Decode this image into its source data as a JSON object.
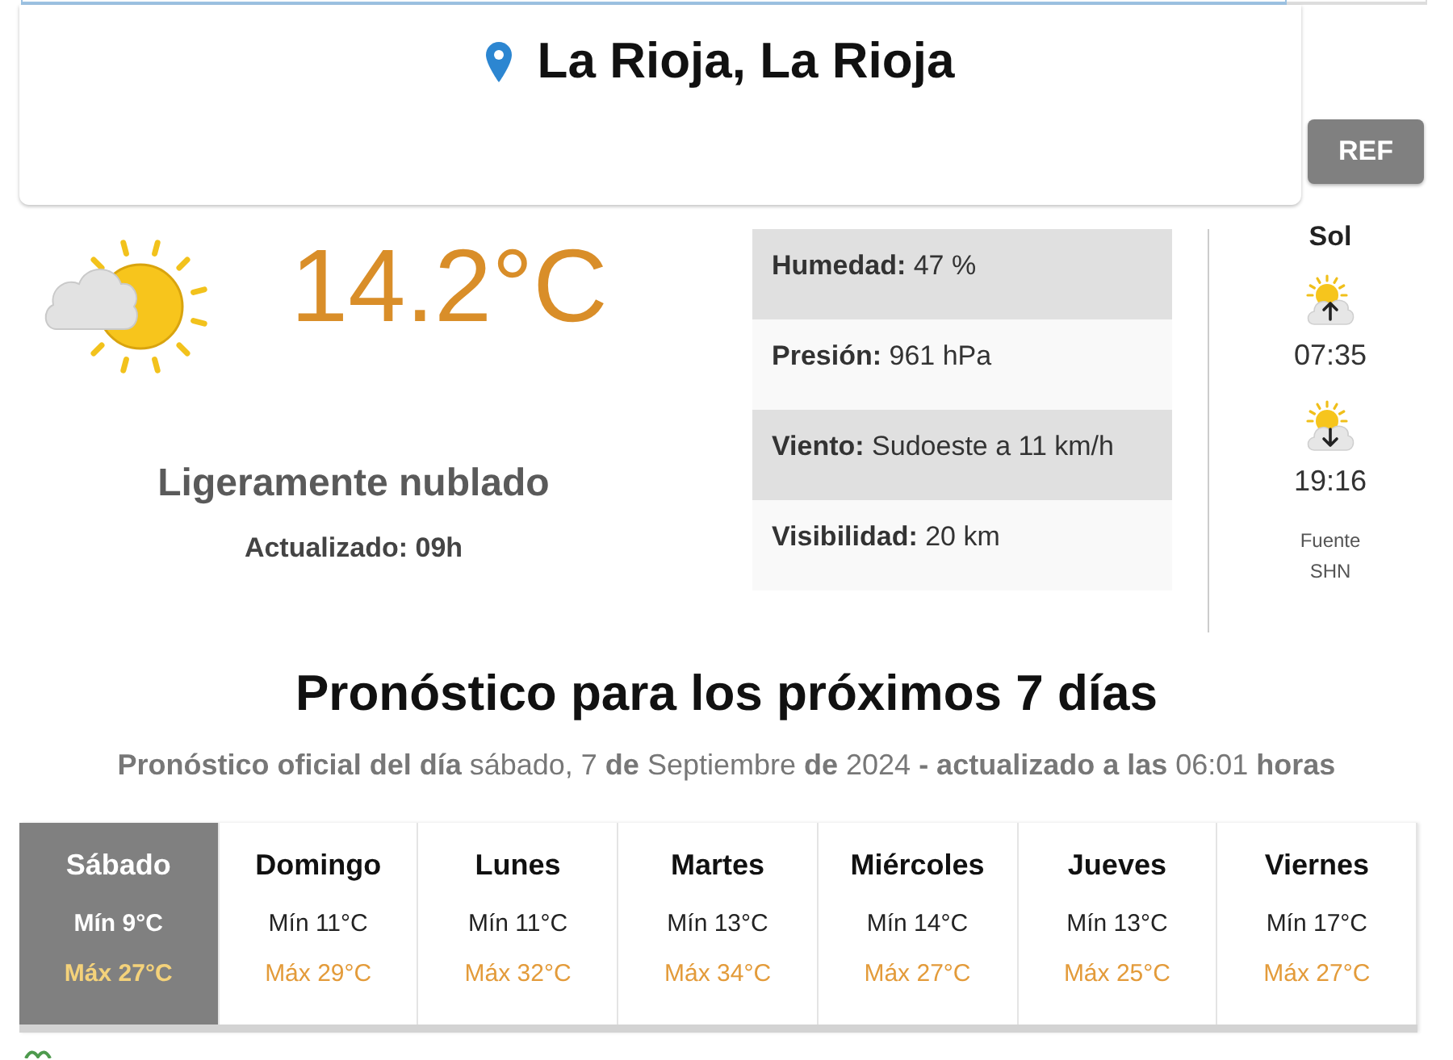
{
  "location": {
    "title": "La Rioja, La Rioja"
  },
  "ref_button": {
    "label": "REF"
  },
  "current": {
    "temperature": "14.2°C",
    "condition": "Ligeramente nublado",
    "updated": "Actualizado: 09h"
  },
  "details": [
    {
      "text": "**Humedad:** 47 %"
    },
    {
      "text": "**Presión:** 961 hPa"
    },
    {
      "text": "**Viento:** Sudoeste a 11 km/h"
    },
    {
      "text": "**Visibilidad:** 20 km"
    }
  ],
  "sun": {
    "title": "Sol",
    "events": [
      {
        "kind": "sunrise",
        "time": "07:35"
      },
      {
        "kind": "sunset",
        "time": "19:16"
      }
    ],
    "source": "Fuente SHN"
  },
  "forecast": {
    "title": "Pronóstico para los próximos 7 días",
    "subtitle": "**Pronóstico oficial del día** sábado, 7 **de** Septiembre **de** 2024 **- actualizado a las** 06:01 **horas**",
    "days": [
      {
        "day": "Sábado",
        "min": "Mín 9°C",
        "max": "Máx 27°C",
        "selected": true
      },
      {
        "day": "Domingo",
        "min": "Mín 11°C",
        "max": "Máx 29°C",
        "selected": false
      },
      {
        "day": "Lunes",
        "min": "Mín 11°C",
        "max": "Máx 32°C",
        "selected": false
      },
      {
        "day": "Martes",
        "min": "Mín 13°C",
        "max": "Máx 34°C",
        "selected": false
      },
      {
        "day": "Miércoles",
        "min": "Mín 14°C",
        "max": "Máx 27°C",
        "selected": false
      },
      {
        "day": "Jueves",
        "min": "Mín 13°C",
        "max": "Máx 25°C",
        "selected": false
      },
      {
        "day": "Viernes",
        "min": "Mín 17°C",
        "max": "Máx 27°C",
        "selected": false
      }
    ]
  }
}
